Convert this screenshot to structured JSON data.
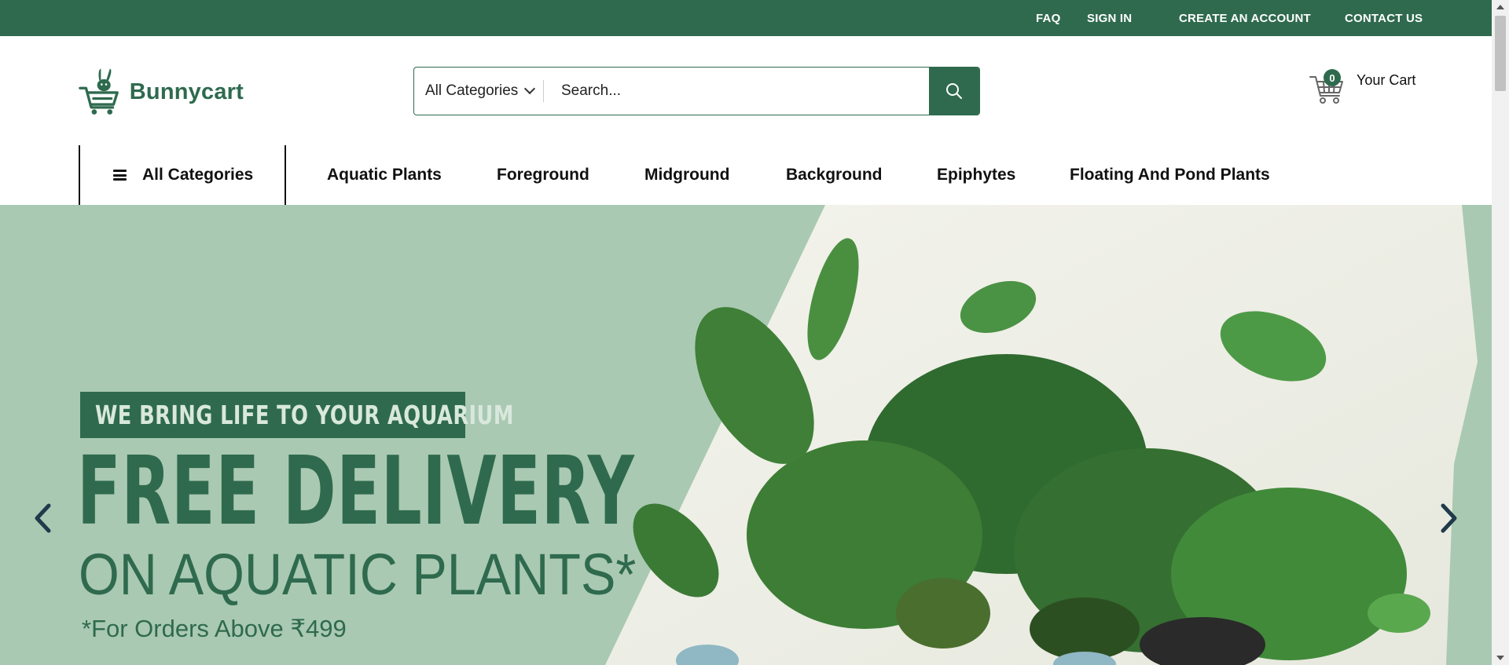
{
  "topbar": {
    "faq": "FAQ",
    "sign_in": "SIGN IN",
    "create_account": "CREATE AN ACCOUNT",
    "contact_us": "CONTACT US"
  },
  "brand": {
    "name": "Bunnycart"
  },
  "search": {
    "category_label": "All Categories",
    "placeholder": "Search..."
  },
  "cart": {
    "count": "0",
    "label": "Your Cart"
  },
  "nav": {
    "all_categories": "All Categories",
    "items": [
      "Aquatic Plants",
      "Foreground",
      "Midground",
      "Background",
      "Epiphytes",
      "Floating And Pond Plants"
    ]
  },
  "hero": {
    "tagline": "WE BRING LIFE TO YOUR AQUARIUM",
    "headline": "FREE DELIVERY",
    "subline": "ON AQUATIC PLANTS*",
    "note": "*For Orders Above ₹499"
  },
  "colors": {
    "brand_green": "#2f6a4e",
    "hero_bg": "#a9c9b2"
  }
}
